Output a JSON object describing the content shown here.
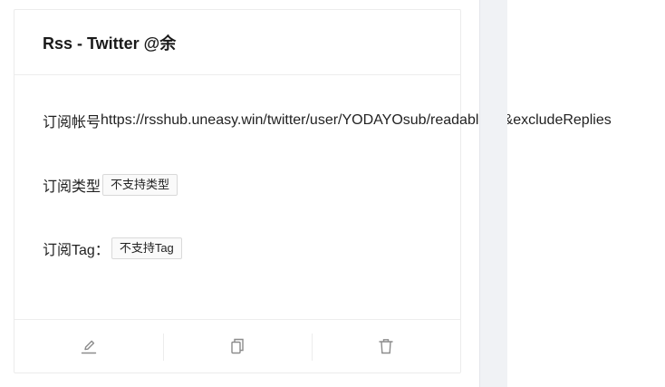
{
  "card": {
    "title": "Rss - Twitter @余",
    "account": {
      "label": "订阅帐号",
      "value": "https://rsshub.uneasy.win/twitter/user/YODAYOsub/readable=1&excludeReplies"
    },
    "type": {
      "label": "订阅类型",
      "tag": "不支持类型"
    },
    "tag_row": {
      "label": "订阅Tag：",
      "tag": "不支持Tag"
    },
    "actions": {
      "edit_icon": "edit-icon",
      "copy_icon": "copy-icon",
      "delete_icon": "delete-icon"
    }
  },
  "colors": {
    "icon": "#8c8c8c",
    "side_panel": "#f0f2f5"
  }
}
